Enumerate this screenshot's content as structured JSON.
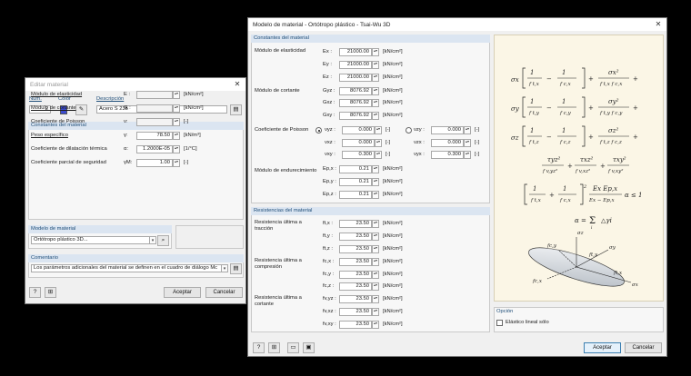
{
  "edit_dialog": {
    "title": "Editar material",
    "close_label": "✕",
    "num_label": "Núm.",
    "num_value": "2",
    "color_label": "Color",
    "color_value": "#3b4bd0",
    "desc_label": "Descripción",
    "desc_value": "Acero S 235",
    "section_constants": "Constantes del material",
    "rows": [
      {
        "label": "Módulo de elasticidad",
        "sym": "E :",
        "value": "",
        "unit": "[kN/cm²]"
      },
      {
        "label": "Módulo de cortante",
        "sym": "G :",
        "value": "",
        "unit": "[kN/cm²]"
      },
      {
        "label": "Coeficiente de Poisson",
        "sym": "ν:",
        "value": "",
        "unit": "[-]"
      },
      {
        "label": "Peso específico",
        "sym": "γ:",
        "value": "78.50",
        "unit": "[kN/m³]"
      },
      {
        "label": "Coeficiente de dilatación térmica",
        "sym": "α:",
        "value": "1.2000E-05",
        "unit": "[1/°C]"
      },
      {
        "label": "Coeficiente parcial de seguridad",
        "sym": "γM:",
        "value": "1.00",
        "unit": "[-]"
      }
    ],
    "section_model": "Modelo de material",
    "model_value": "Ortótropo plástico 3D...",
    "section_comment": "Comentario",
    "comment_value": "Los parámetros adicionales del material se definen en el cuadro de diálogo Mc",
    "accept": "Aceptar",
    "cancel": "Cancelar"
  },
  "model_dialog": {
    "title": "Modelo de material - Ortótropo plástico - Tsai-Wu 3D",
    "close_label": "✕",
    "section_constants": "Constantes del material",
    "elasticity_label": "Módulo de elasticidad",
    "elasticity": [
      {
        "sym": "Ex :",
        "value": "21000.00",
        "unit": "[kN/cm²]"
      },
      {
        "sym": "Ey :",
        "value": "21000.00",
        "unit": "[kN/cm²]"
      },
      {
        "sym": "Ez :",
        "value": "21000.00",
        "unit": "[kN/cm²]"
      }
    ],
    "shear_label": "Módulo de cortante",
    "shear": [
      {
        "sym": "Gyz :",
        "value": "8076.92",
        "unit": "[kN/cm²]"
      },
      {
        "sym": "Gxz :",
        "value": "8076.92",
        "unit": "[kN/cm²]"
      },
      {
        "sym": "Gxy :",
        "value": "8076.92",
        "unit": "[kN/cm²]"
      }
    ],
    "poisson_label": "Coeficiente de Poisson",
    "poisson_left": [
      {
        "sym": "νyz :",
        "value": "0.000",
        "unit": "[-]"
      },
      {
        "sym": "νxz :",
        "value": "0.000",
        "unit": "[-]"
      },
      {
        "sym": "νxy :",
        "value": "0.300",
        "unit": "[-]"
      }
    ],
    "poisson_right": [
      {
        "sym": "νzy :",
        "value": "0.000",
        "unit": "[-]"
      },
      {
        "sym": "νzx :",
        "value": "0.000",
        "unit": "[-]"
      },
      {
        "sym": "νyx :",
        "value": "0.300",
        "unit": "[-]"
      }
    ],
    "hardening_label": "Módulo de endurecimiento",
    "hardening": [
      {
        "sym": "Ep,x :",
        "value": "0.21",
        "unit": "[kN/cm²]"
      },
      {
        "sym": "Ep,y :",
        "value": "0.21",
        "unit": "[kN/cm²]"
      },
      {
        "sym": "Ep,z :",
        "value": "0.21",
        "unit": "[kN/cm²]"
      }
    ],
    "section_strength": "Resistencias del material",
    "tension_label": "Resistencia última a\ntracción",
    "tension": [
      {
        "sym": "ft,x :",
        "value": "23.50",
        "unit": "[kN/cm²]"
      },
      {
        "sym": "ft,y :",
        "value": "23.50",
        "unit": "[kN/cm²]"
      },
      {
        "sym": "ft,z :",
        "value": "23.50",
        "unit": "[kN/cm²]"
      }
    ],
    "compression_label": "Resistencia última a\ncompresión",
    "compression": [
      {
        "sym": "fc,x :",
        "value": "23.50",
        "unit": "[kN/cm²]"
      },
      {
        "sym": "fc,y :",
        "value": "23.50",
        "unit": "[kN/cm²]"
      },
      {
        "sym": "fc,z :",
        "value": "23.50",
        "unit": "[kN/cm²]"
      }
    ],
    "shearstr_label": "Resistencia última a\ncortante",
    "shearstr": [
      {
        "sym": "fv,yz :",
        "value": "23.50",
        "unit": "[kN/cm²]"
      },
      {
        "sym": "fv,xz :",
        "value": "23.50",
        "unit": "[kN/cm²]"
      },
      {
        "sym": "fv,xy :",
        "value": "23.50",
        "unit": "[kN/cm²]"
      }
    ],
    "formula": {
      "sigma_x": "σx",
      "sigma_y": "σy",
      "sigma_z": "σz",
      "line1": "[ 1/ft,x − 1/fc,x ] + σx² / (ft,x fc,x) +",
      "alpha": "α = Σ △γi",
      "criterion": "[ 1/ft,x + 1/fc,x ]² · Ex Ep,x / (Ex − Ep,x) · α ≤ 1"
    },
    "diagram_labels": {
      "ftx": "ft,x",
      "fty": "ft,y",
      "fcx": "fc,x",
      "fcy": "fc,y",
      "sx": "σx",
      "sy": "σy",
      "sz": "σz"
    },
    "section_option": "Opción",
    "option_label": "Elástico lineal sólo",
    "accept": "Aceptar",
    "cancel": "Cancelar"
  }
}
